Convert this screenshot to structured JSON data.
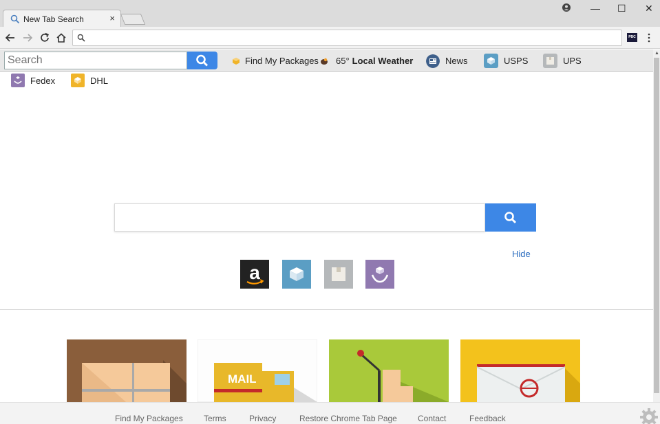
{
  "browser": {
    "tab_title": "New Tab Search",
    "tab_close": "×",
    "omnibox_value": "",
    "extension_badge": "PBC"
  },
  "window_controls": {
    "minimize": "—",
    "maximize": "☐",
    "close": "✕"
  },
  "extbar": {
    "search_placeholder": "Search",
    "items": [
      {
        "label": "Find My Packages",
        "icon": "package-icon"
      },
      {
        "label": "Local Weather",
        "temp": "65°",
        "icon": "weather-icon"
      },
      {
        "label": "News",
        "icon": "news-icon"
      },
      {
        "label": "USPS",
        "icon": "usps-icon"
      },
      {
        "label": "UPS",
        "icon": "ups-icon"
      }
    ],
    "subrow": [
      {
        "label": "Fedex",
        "icon": "fedex-icon"
      },
      {
        "label": "DHL",
        "icon": "dhl-icon"
      }
    ]
  },
  "main": {
    "search_value": "",
    "hide_label": "Hide",
    "quicklinks": [
      "amazon-icon",
      "usps-icon",
      "ups-icon",
      "fedex-icon"
    ],
    "card_mail_text": "MAIL"
  },
  "footer": {
    "links": [
      "Find My Packages",
      "Terms",
      "Privacy",
      "Restore Chrome Tab Page",
      "Contact",
      "Feedback"
    ]
  },
  "colors": {
    "accent": "#3d87e6",
    "usps": "#5b9ec4",
    "ups": "#b5b8ba",
    "fedex": "#9079b0",
    "dhl": "#f0b429",
    "amazon": "#222222"
  }
}
